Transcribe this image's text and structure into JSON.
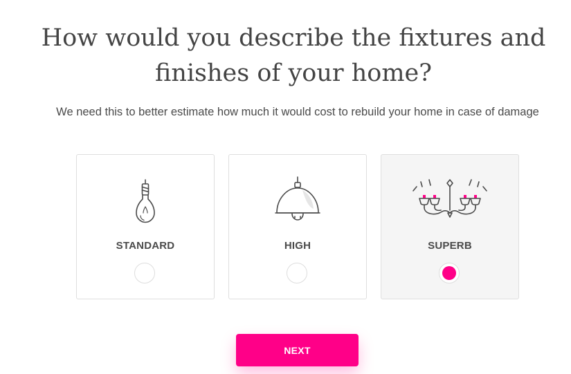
{
  "question": {
    "title_line1": "How would you describe the fixtures and",
    "title_line2": "finishes of your home?",
    "subtitle": "We need this to better estimate how much it would cost to rebuild your home in case of damage"
  },
  "options": [
    {
      "label": "STANDARD",
      "icon": "light-bulb-icon",
      "selected": false
    },
    {
      "label": "HIGH",
      "icon": "pendant-lamp-icon",
      "selected": false
    },
    {
      "label": "SUPERB",
      "icon": "chandelier-icon",
      "selected": true
    }
  ],
  "next_label": "NEXT",
  "colors": {
    "accent": "#ff0088",
    "text": "#4a4a4a",
    "card_border": "#dedede",
    "selected_card_bg": "#f5f5f5"
  }
}
